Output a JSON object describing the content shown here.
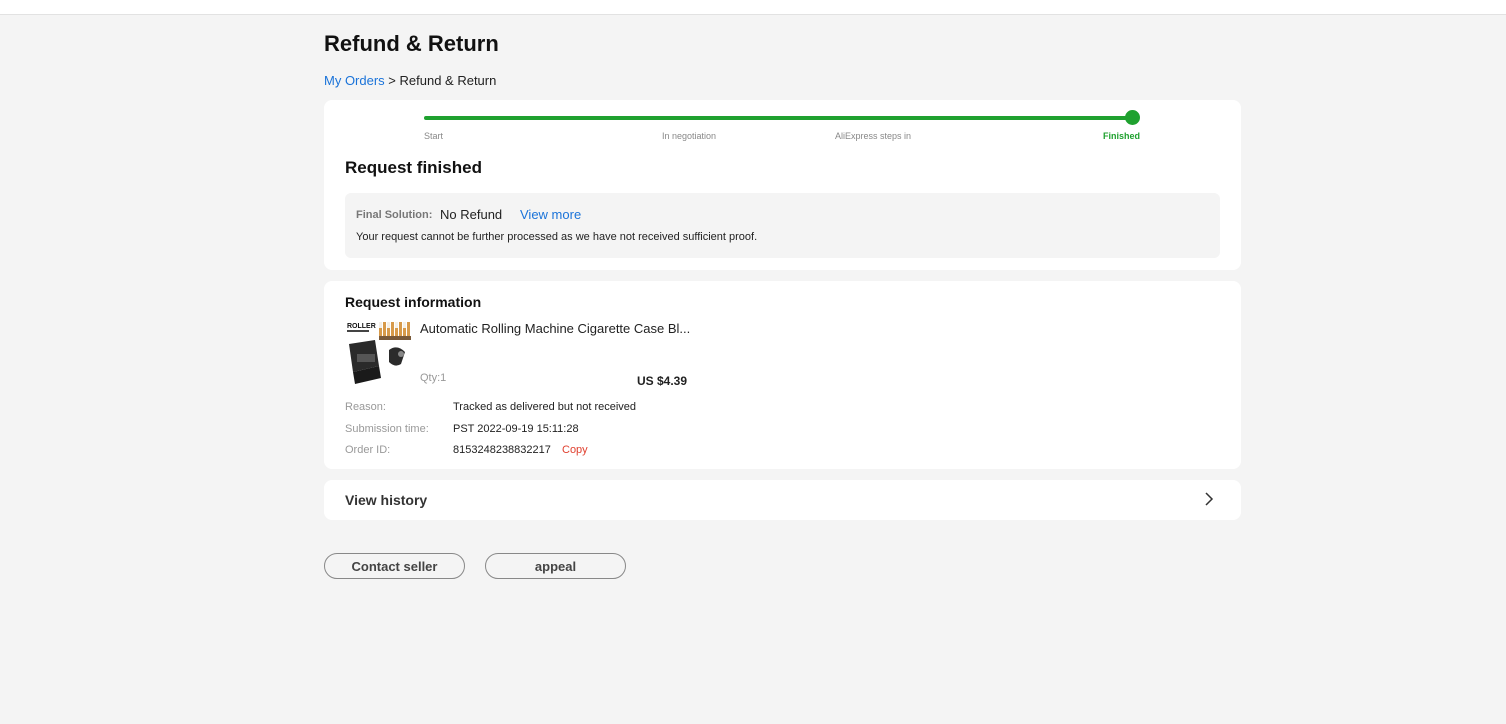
{
  "page": {
    "title": "Refund & Return"
  },
  "breadcrumb": {
    "parent": "My Orders",
    "separator": ">",
    "current": "Refund & Return"
  },
  "progress": {
    "steps": [
      {
        "label": "Start"
      },
      {
        "label": "In negotiation"
      },
      {
        "label": "AliExpress steps in"
      },
      {
        "label": "Finished"
      }
    ],
    "active_step": 4,
    "completion": 1.0,
    "accent_color": "#1fa12f"
  },
  "status": {
    "title": "Request finished",
    "solution_label": "Final Solution:",
    "solution_value": "No Refund",
    "view_more": "View more",
    "description": "Your request cannot be further processed as we have not received sufficient proof."
  },
  "request_info": {
    "title": "Request information",
    "product": {
      "name": "Automatic Rolling Machine Cigarette Case Bl...",
      "thumbnail_text": "ROLLER",
      "qty": "Qty:1",
      "price": "US $4.39"
    },
    "reason_label": "Reason:",
    "reason_value": "Tracked as delivered but not received",
    "submission_label": "Submission time:",
    "submission_value": "PST 2022-09-19 15:11:28",
    "order_label": "Order ID:",
    "order_value": "8153248238832217",
    "copy_label": "Copy"
  },
  "history": {
    "label": "View history"
  },
  "actions": {
    "contact_seller": "Contact seller",
    "appeal": "appeal"
  },
  "colors": {
    "link": "#1a73d9",
    "copy": "#e0402f",
    "background": "#f4f4f4"
  }
}
